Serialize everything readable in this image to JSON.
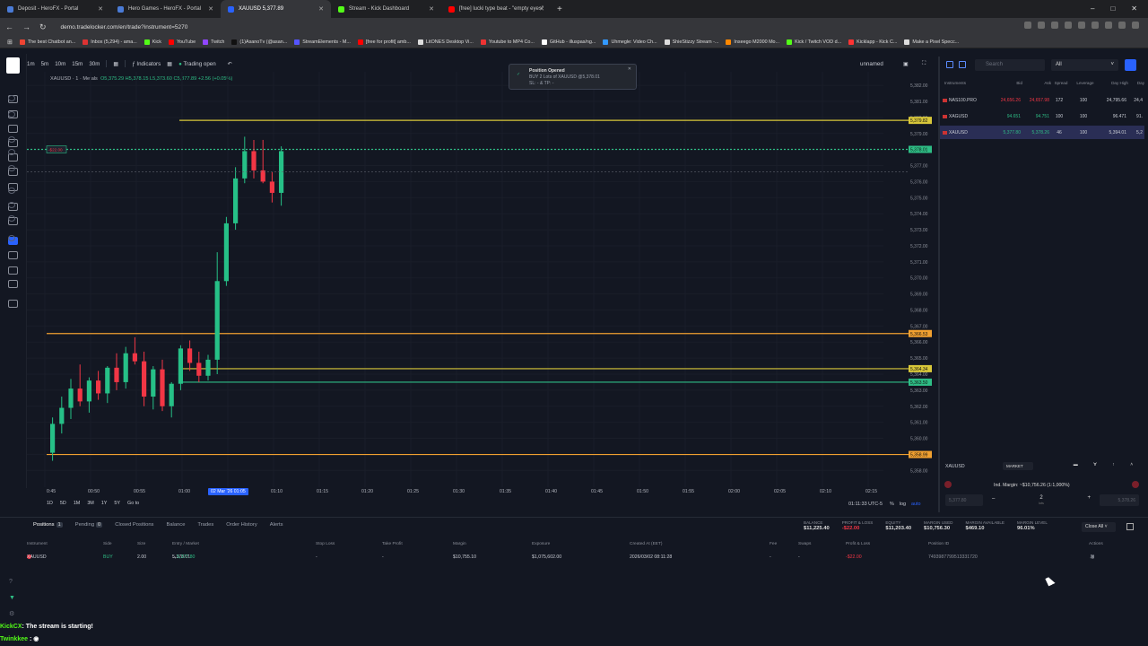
{
  "browser": {
    "tabs": [
      {
        "title": "Deposit - HeroFX - Portal",
        "color": "#4a7bd6",
        "active": false
      },
      {
        "title": "Hero Games - HeroFX - Portal",
        "color": "#4a7bd6",
        "active": false
      },
      {
        "title": "XAUUSD 5,377.89",
        "color": "#2962ff",
        "active": true
      },
      {
        "title": "Stream - Kick Dashboard",
        "color": "#53fc18",
        "active": false
      },
      {
        "title": "[free] lucki type beat - \"empty eyes\"",
        "color": "#ff0000",
        "active": false
      }
    ],
    "url": "demo.tradelocker.com/en/trade?instrument=5270",
    "bookmarks": [
      {
        "label": "The best Chatbot an...",
        "color": "#e43"
      },
      {
        "label": "Inbox (5,294) - ama...",
        "color": "#d33"
      },
      {
        "label": "Kick",
        "color": "#53fc18"
      },
      {
        "label": "YouTube",
        "color": "#f00"
      },
      {
        "label": "Twitch",
        "color": "#9146ff"
      },
      {
        "label": "(1)AsanoTv (@asan...",
        "color": "#111"
      },
      {
        "label": "StreamElements - M...",
        "color": "#55f"
      },
      {
        "label": "[free for profit] amb...",
        "color": "#f00"
      },
      {
        "label": "LitONES Desktop Vi...",
        "color": "#ddd"
      },
      {
        "label": "Youtube to MP4 Co...",
        "color": "#e33"
      },
      {
        "label": "GitHub - illuspas/ng...",
        "color": "#fff"
      },
      {
        "label": "Uhmegle: Video Ch...",
        "color": "#39f"
      },
      {
        "label": "ShieStizzy Stream -...",
        "color": "#ddd"
      },
      {
        "label": "Inseego M2000 Mo...",
        "color": "#f80"
      },
      {
        "label": "Kick / Twitch VOD d...",
        "color": "#53fc18"
      },
      {
        "label": "Kicklapp - Kick C...",
        "color": "#f33"
      },
      {
        "label": "Make a Pixel Specc...",
        "color": "#ddd"
      }
    ]
  },
  "topbar": {
    "timeframes": [
      "1m",
      "5m",
      "10m",
      "15m",
      "30m"
    ],
    "indicators": "Indicators",
    "trading_status": "Trading open",
    "layout_name": "unnamed"
  },
  "toast": {
    "title": "Position Opened",
    "line1": "BUY 2 Lots of XAUUSD @5,378.01",
    "line2": "SL: - & TP: -"
  },
  "legend": {
    "symbol": "XAUUSD · 1 · Metals",
    "ohlc": "O5,375.29 H5,378.15 L5,373.60 C5,377.89 +2.56 (+0.05%)"
  },
  "chart_data": {
    "type": "candlestick",
    "ylim": [
      5357.4,
      5382.4
    ],
    "y_ticks": [
      "5,382.00",
      "5,381.00",
      "5,380.00",
      "5,379.00",
      "5,378.00",
      "5,377.00",
      "5,376.00",
      "5,375.00",
      "5,374.00",
      "5,373.00",
      "5,372.00",
      "5,371.00",
      "5,370.00",
      "5,369.00",
      "5,368.00",
      "5,367.00",
      "5,366.00",
      "5,365.00",
      "5,364.00",
      "5,363.00",
      "5,362.00",
      "5,361.00",
      "5,360.00",
      "5,359.00",
      "5,358.00"
    ],
    "x_ticks": [
      "0:45",
      "00:50",
      "00:55",
      "01:00",
      "02 Mar '26 01:05",
      "01:10",
      "01:15",
      "01:20",
      "01:25",
      "01:30",
      "01:35",
      "01:40",
      "01:45",
      "01:50",
      "01:55",
      "02:00",
      "02:05",
      "02:10",
      "02:15"
    ],
    "candles": [
      [
        5359.1,
        5361.3,
        5358.6,
        5360.9
      ],
      [
        5360.9,
        5362.6,
        5360.3,
        5361.9
      ],
      [
        5361.9,
        5363.7,
        5361.2,
        5363.1
      ],
      [
        5363.1,
        5364.6,
        5362.0,
        5362.3
      ],
      [
        5362.3,
        5363.8,
        5361.6,
        5363.6
      ],
      [
        5363.6,
        5364.2,
        5362.4,
        5362.8
      ],
      [
        5362.8,
        5364.5,
        5362.2,
        5364.4
      ],
      [
        5364.4,
        5365.3,
        5363.0,
        5363.5
      ],
      [
        5363.5,
        5365.7,
        5363.1,
        5365.3
      ],
      [
        5365.3,
        5366.3,
        5364.6,
        5364.8
      ],
      [
        5364.8,
        5365.4,
        5362.0,
        5362.6
      ],
      [
        5362.6,
        5364.5,
        5361.8,
        5364.3
      ],
      [
        5364.3,
        5364.9,
        5361.7,
        5362.0
      ],
      [
        5362.0,
        5363.5,
        5361.3,
        5363.4
      ],
      [
        5363.4,
        5365.8,
        5363.0,
        5365.6
      ],
      [
        5365.6,
        5366.1,
        5364.2,
        5364.7
      ],
      [
        5364.7,
        5365.4,
        5363.5,
        5363.9
      ],
      [
        5363.9,
        5365.2,
        5363.6,
        5364.9
      ],
      [
        5364.9,
        5371.6,
        5364.0,
        5369.8
      ],
      [
        5369.8,
        5373.8,
        5369.5,
        5373.4
      ],
      [
        5373.4,
        5376.9,
        5373.0,
        5376.2
      ],
      [
        5376.2,
        5378.8,
        5375.9,
        5377.9
      ],
      [
        5377.9,
        5378.6,
        5376.2,
        5376.7
      ],
      [
        5376.7,
        5378.6,
        5375.9,
        5376.0
      ],
      [
        5376.0,
        5376.6,
        5374.7,
        5375.3
      ],
      [
        5375.3,
        5378.2,
        5374.5,
        5377.9
      ]
    ],
    "levels": [
      {
        "price": "5,379.82",
        "value": 5379.82,
        "color": "#d8c73a"
      },
      {
        "price": "5,378.01",
        "value": 5378.01,
        "color": "#2ebd85"
      },
      {
        "price": "5,366.53",
        "value": 5366.53,
        "color": "#f0a030"
      },
      {
        "price": "5,364.34",
        "value": 5364.34,
        "color": "#d8c73a"
      },
      {
        "price": "5,363.50",
        "value": 5363.5,
        "color": "#2ebd85"
      },
      {
        "price": "5,358.99",
        "value": 5358.99,
        "color": "#f0a030"
      }
    ],
    "position_label": "-$22.00"
  },
  "bottom_timeframes": [
    "1D",
    "5D",
    "1M",
    "3M",
    "1Y",
    "5Y",
    "Go to"
  ],
  "utc_time": "01:11:33 UTC-5",
  "axis_modes": [
    "%",
    "log",
    "auto"
  ],
  "watchlist": {
    "search_placeholder": "Search",
    "filter": "All",
    "headers": [
      "Instruments",
      "Bid",
      "Ask",
      "Spread",
      "Leverage",
      "Day High",
      "Day"
    ],
    "rows": [
      {
        "name": "NAS100.PRO",
        "bid": "24,656.26",
        "ask": "24,657.98",
        "spread": "172",
        "lev": "100",
        "high": "24,795.66",
        "low": "24,4",
        "dir": "down",
        "selected": false
      },
      {
        "name": "XAGUSD",
        "bid": "94.651",
        "ask": "94.751",
        "spread": "100",
        "lev": "100",
        "high": "96.471",
        "low": "91.",
        "dir": "up",
        "selected": false
      },
      {
        "name": "XAUUSD",
        "bid": "5,377.80",
        "ask": "5,378.26",
        "spread": "46",
        "lev": "100",
        "high": "5,394.01",
        "low": "5,2",
        "dir": "up",
        "selected": true
      }
    ]
  },
  "order_panel": {
    "symbol": "XAUUSD",
    "type": "MARKET",
    "margin": "Ind. Margin: ~$10,756.26 (1:1,000%)",
    "sell_price": "5,377.80",
    "qty": "2",
    "qty_unit": "lots",
    "buy_price": "5,378.26"
  },
  "bottom": {
    "tabs": [
      {
        "label": "Positions",
        "badge": "1",
        "active": true
      },
      {
        "label": "Pending",
        "badge": "0",
        "active": false
      },
      {
        "label": "Closed Positions",
        "badge": "",
        "active": false
      },
      {
        "label": "Balance",
        "badge": "",
        "active": false
      },
      {
        "label": "Trades",
        "badge": "",
        "active": false
      },
      {
        "label": "Order History",
        "badge": "",
        "active": false
      },
      {
        "label": "Alerts",
        "badge": "",
        "active": false
      }
    ],
    "stats": [
      {
        "label": "BALANCE",
        "value": "$11,225.40",
        "color": "#dddddd"
      },
      {
        "label": "PROFIT & LOSS",
        "value": "-$22.00",
        "color": "#f23645"
      },
      {
        "label": "EQUITY",
        "value": "$11,203.40",
        "color": "#dddddd"
      },
      {
        "label": "MARGIN USED",
        "value": "$10,756.30",
        "color": "#dddddd"
      },
      {
        "label": "MARGIN AVAILABLE",
        "value": "$469.10",
        "color": "#dddddd"
      },
      {
        "label": "MARGIN LEVEL",
        "value": "96.01%",
        "color": "#dddddd"
      }
    ],
    "close_all": "Close All",
    "columns": [
      "Instrument",
      "Side",
      "Size",
      "Entry / Market",
      "Stop Loss",
      "Take Profit",
      "Margin",
      "Exposure",
      "Created At (EET)",
      "Fee",
      "Swaps",
      "Profit & Loss",
      "Position ID",
      "Actions"
    ],
    "row": {
      "instrument": "XAUUSD",
      "side": "BUY",
      "size": "2.00",
      "entry": "5,378.01",
      "market": "5,377.80",
      "sl": "-",
      "tp": "-",
      "margin": "$10,755.10",
      "exposure": "$1,075,602.00",
      "created": "2026/03/02 08:11:28",
      "fee": "-",
      "swaps": "-",
      "pnl": "-$22.00",
      "position_id": "7493987799513331720"
    }
  },
  "chat": {
    "line1_user": "KickCX",
    "line1_text": ": The stream is starting!",
    "line2_user": "Twinkkee",
    "line2_text": ":"
  }
}
